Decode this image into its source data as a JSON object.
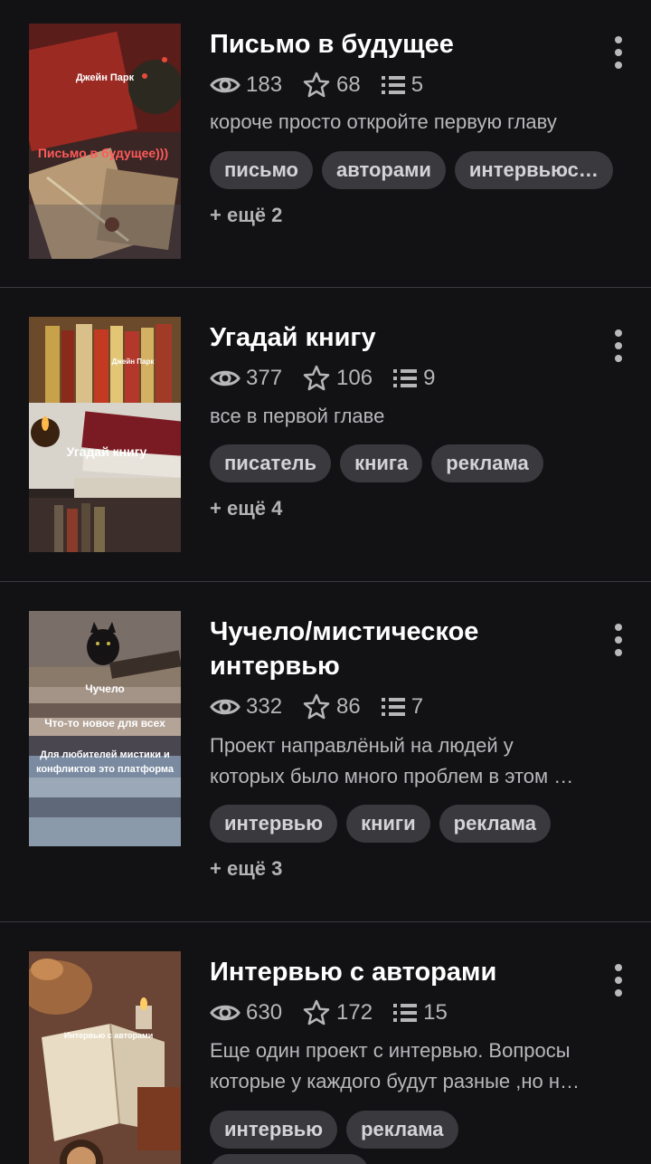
{
  "stories": [
    {
      "title_lines": [
        "Письмо в будущее"
      ],
      "views": "183",
      "votes": "68",
      "parts": "5",
      "description_lines": [
        "короче просто откройте первую главу"
      ],
      "tags": [
        "письмо",
        "авторами",
        "интервьюс…"
      ],
      "more_tags": "+ ещё 2",
      "cover_text": [
        "Джейн Парк",
        "Письмо в будущее)))"
      ],
      "icons": {
        "views": "eye-icon",
        "votes": "star-icon",
        "parts": "list-icon",
        "menu": "more-vertical-icon"
      }
    },
    {
      "title_lines": [
        "Угадай книгу"
      ],
      "views": "377",
      "votes": "106",
      "parts": "9",
      "description_lines": [
        "все в первой главе"
      ],
      "tags": [
        "писатель",
        "книга",
        "реклама"
      ],
      "more_tags": "+ ещё 4",
      "cover_text": [
        "Джейн Парк",
        "Угадай книгу"
      ],
      "icons": {
        "views": "eye-icon",
        "votes": "star-icon",
        "parts": "list-icon",
        "menu": "more-vertical-icon"
      }
    },
    {
      "title_lines": [
        "Чучело/мистическое",
        "интервью"
      ],
      "views": "332",
      "votes": "86",
      "parts": "7",
      "description_lines": [
        "Проект направлёный на людей у",
        "которых было много проблем в этом …"
      ],
      "tags": [
        "интервью",
        "книги",
        "реклама"
      ],
      "more_tags": "+ ещё 3",
      "cover_text": [
        "Чучело",
        "Что-то новое для всех",
        "Для любителей мистики и",
        "конфликтов это платформа"
      ],
      "icons": {
        "views": "eye-icon",
        "votes": "star-icon",
        "parts": "list-icon",
        "menu": "more-vertical-icon"
      }
    },
    {
      "title_lines": [
        "Интервью с авторами"
      ],
      "views": "630",
      "votes": "172",
      "parts": "15",
      "description_lines": [
        "Еще один проект с интервью. Вопросы",
        "которые у каждого будут разные ,но н…"
      ],
      "tags": [
        "интервью",
        "реклама"
      ],
      "more_tags": "",
      "cover_text": [
        "Интервью с авторами"
      ],
      "icons": {
        "views": "eye-icon",
        "votes": "star-icon",
        "parts": "list-icon",
        "menu": "more-vertical-icon"
      }
    }
  ],
  "colors": {
    "background": "#121114",
    "tag_bg": "#3a393d",
    "divider": "#3b3a3e",
    "muted_text": "#b6b6b9"
  }
}
